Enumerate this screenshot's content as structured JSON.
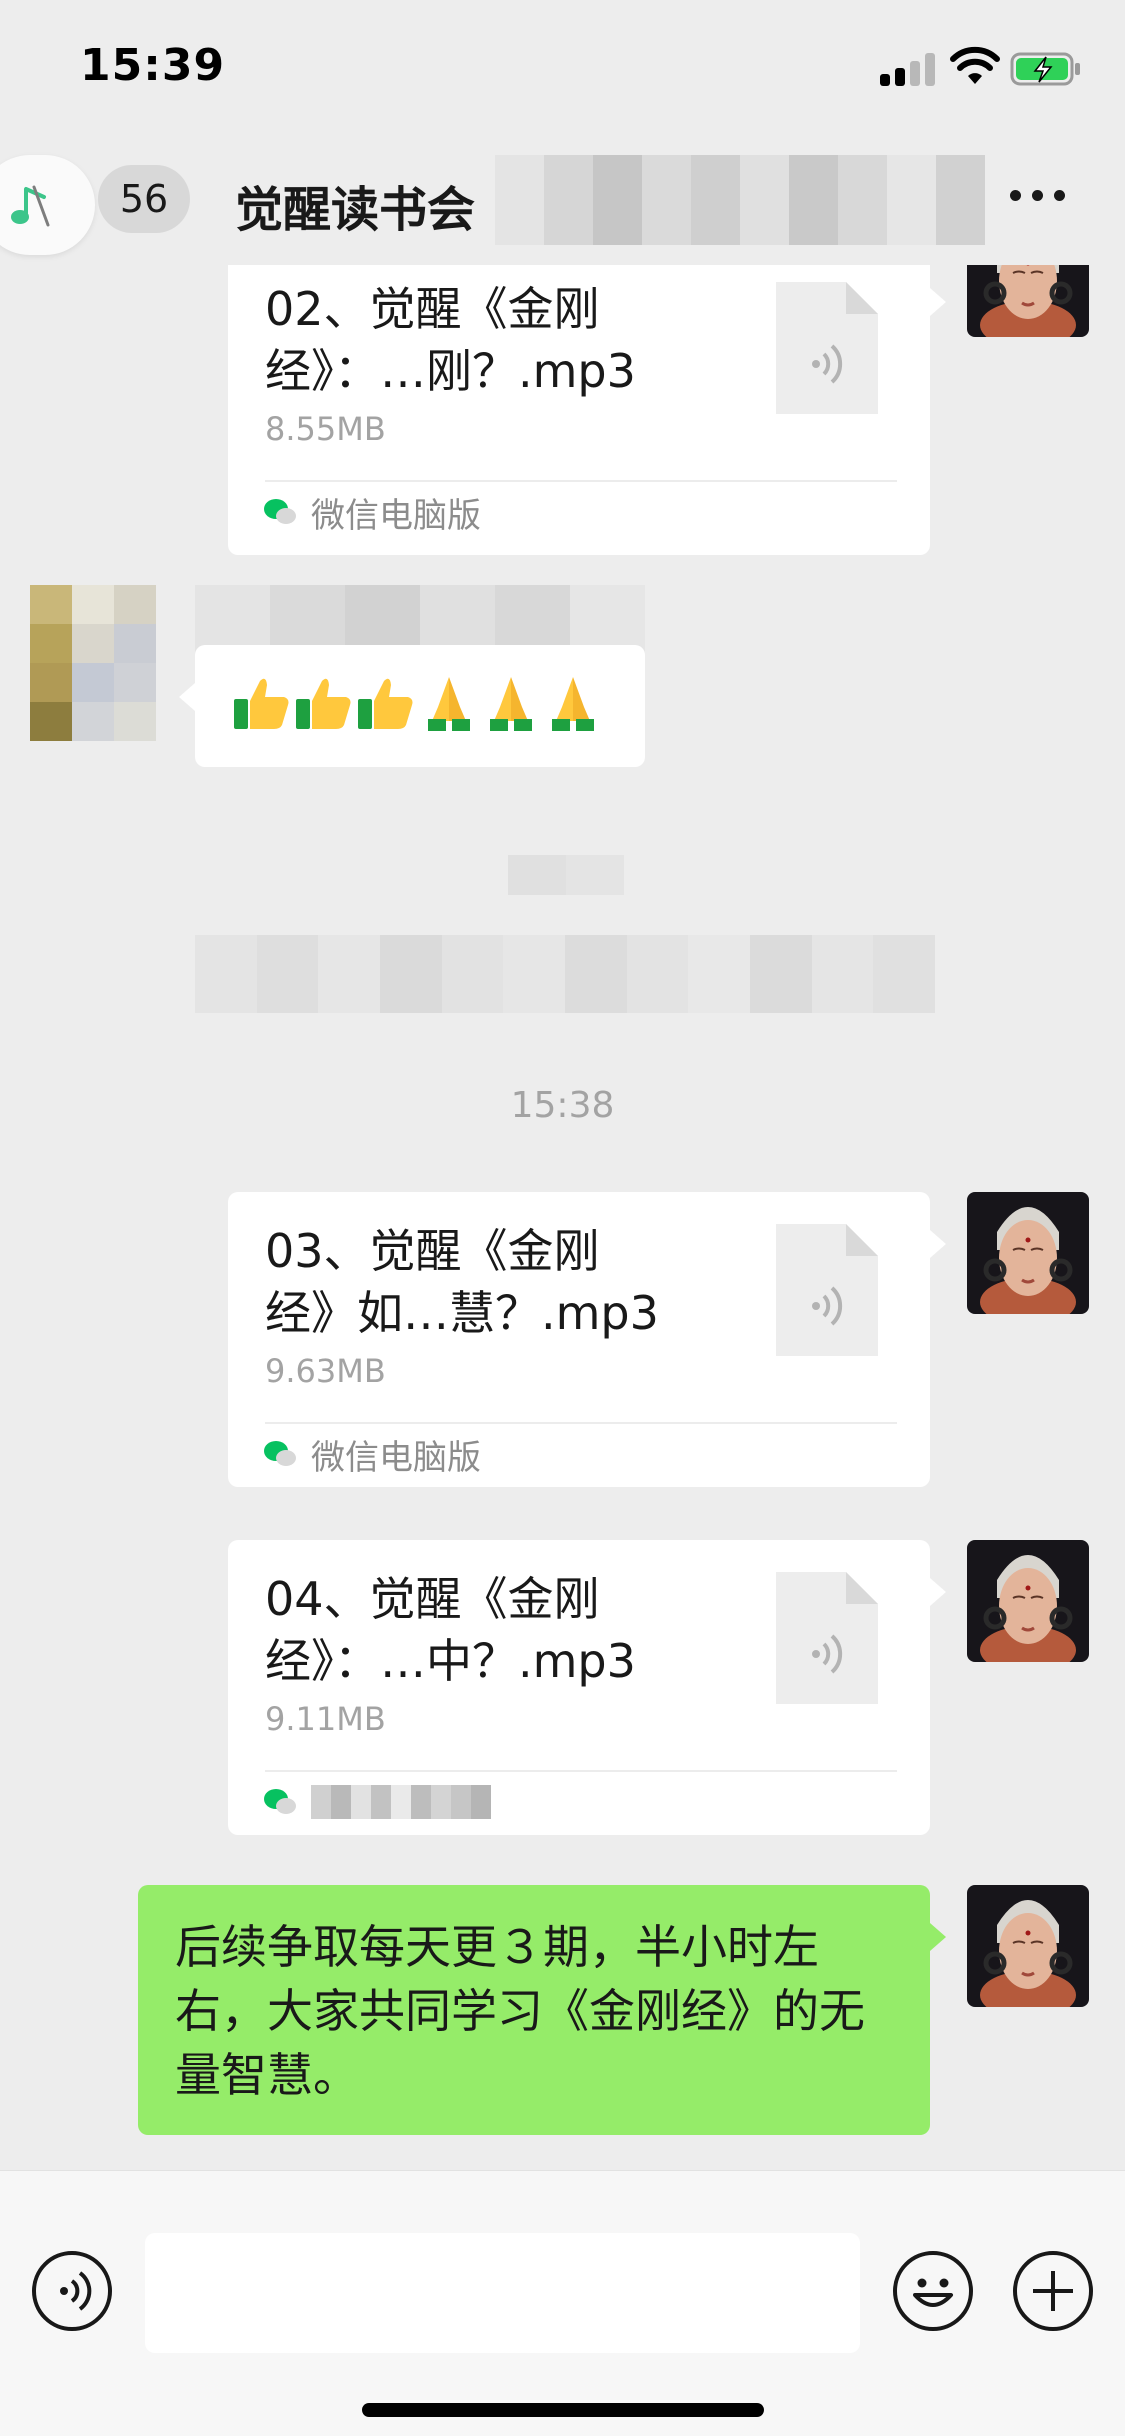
{
  "status_bar": {
    "time": "15:39"
  },
  "nav": {
    "unread_count": "56",
    "title": "觉醒读书会"
  },
  "messages": [
    {
      "type": "file",
      "name": "02、觉醒《金刚经》：…刚？.mp3",
      "name_line1": "02、觉醒《金刚",
      "name_line2": "经》：…刚？.mp3",
      "size": "8.55MB",
      "source": "微信电脑版"
    },
    {
      "type": "emoji",
      "icons": [
        "thumbs-up-emoji",
        "thumbs-up-emoji",
        "thumbs-up-emoji",
        "folded-hands-emoji",
        "folded-hands-emoji",
        "folded-hands-emoji"
      ]
    },
    {
      "type": "timestamp",
      "text": "15:38"
    },
    {
      "type": "file",
      "name": "03、觉醒《金刚经》如…慧？.mp3",
      "name_line1": "03、觉醒《金刚",
      "name_line2": "经》如…慧？.mp3",
      "size": "9.63MB",
      "source": "微信电脑版"
    },
    {
      "type": "file",
      "name": "04、觉醒《金刚经》：…中？.mp3",
      "name_line1": "04、觉醒《金刚",
      "name_line2": "经》：…中？.mp3",
      "size": "9.11MB",
      "source": ""
    },
    {
      "type": "text",
      "text": "后续争取每天更３期，半小时左右，大家共同学习《金刚经》的无量智慧。"
    }
  ],
  "input": {
    "value": "",
    "placeholder": ""
  },
  "colors": {
    "background": "#ededed",
    "self_bubble": "#95ec69",
    "other_bubble": "#ffffff",
    "wechat_green": "#07c160",
    "muted_text": "#a3a3a3"
  }
}
